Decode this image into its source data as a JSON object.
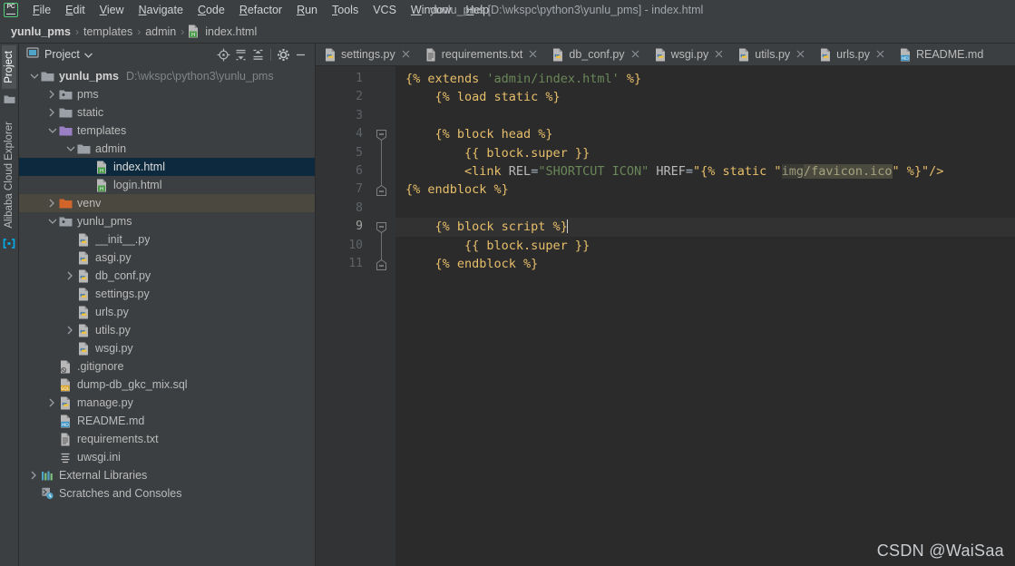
{
  "window": {
    "title": "yunlu_pms [D:\\wkspc\\python3\\yunlu_pms] - index.html",
    "logo_text": "PC"
  },
  "menubar": {
    "items": [
      {
        "label": "File",
        "mnemonic": "F"
      },
      {
        "label": "Edit",
        "mnemonic": "E"
      },
      {
        "label": "View",
        "mnemonic": "V"
      },
      {
        "label": "Navigate",
        "mnemonic": "N"
      },
      {
        "label": "Code",
        "mnemonic": "C"
      },
      {
        "label": "Refactor",
        "mnemonic": "R"
      },
      {
        "label": "Run",
        "mnemonic": "R"
      },
      {
        "label": "Tools",
        "mnemonic": "T"
      },
      {
        "label": "VCS",
        "mnemonic": ""
      },
      {
        "label": "Window",
        "mnemonic": "W"
      },
      {
        "label": "Help",
        "mnemonic": "H"
      }
    ]
  },
  "breadcrumb": {
    "items": [
      "yunlu_pms",
      "templates",
      "admin",
      "index.html"
    ],
    "separator": "›",
    "file_icon": "html-file-icon"
  },
  "toolstrip": {
    "tabs": [
      {
        "label": "Project",
        "active": true,
        "icon": "folder-icon"
      },
      {
        "label": "Alibaba Cloud Explorer",
        "active": false,
        "icon": "cloud-bracket-icon"
      }
    ]
  },
  "project_panel": {
    "title": "Project",
    "caret_icon": "chevron-down-icon",
    "buttons": [
      {
        "name": "locate-icon",
        "title": "Select Opened File"
      },
      {
        "name": "expand-all-icon",
        "title": "Expand All"
      },
      {
        "name": "collapse-all-icon",
        "title": "Collapse All"
      },
      {
        "name": "gear-icon",
        "title": "Settings"
      },
      {
        "name": "minimize-icon",
        "title": "Hide"
      }
    ],
    "tree": [
      {
        "label": "yunlu_pms",
        "path": "D:\\wkspc\\python3\\yunlu_pms",
        "indent": 0,
        "arrow": "down",
        "icon": "module-folder",
        "bold": true,
        "state": "normal"
      },
      {
        "label": "pms",
        "indent": 1,
        "arrow": "right",
        "icon": "package-folder",
        "state": "normal"
      },
      {
        "label": "static",
        "indent": 1,
        "arrow": "right",
        "icon": "folder-gray",
        "state": "normal"
      },
      {
        "label": "templates",
        "indent": 1,
        "arrow": "down",
        "icon": "folder-purple",
        "state": "normal"
      },
      {
        "label": "admin",
        "indent": 2,
        "arrow": "down",
        "icon": "folder-gray",
        "state": "normal"
      },
      {
        "label": "index.html",
        "indent": 3,
        "arrow": "none",
        "icon": "html-file",
        "state": "selected"
      },
      {
        "label": "login.html",
        "indent": 3,
        "arrow": "none",
        "icon": "html-file",
        "state": "normal"
      },
      {
        "label": "venv",
        "indent": 1,
        "arrow": "right",
        "icon": "folder-orange",
        "state": "highlight"
      },
      {
        "label": "yunlu_pms",
        "indent": 1,
        "arrow": "down",
        "icon": "package-folder",
        "state": "normal"
      },
      {
        "label": "__init__.py",
        "indent": 2,
        "arrow": "none",
        "icon": "py-file",
        "state": "normal"
      },
      {
        "label": "asgi.py",
        "indent": 2,
        "arrow": "none",
        "icon": "py-file",
        "state": "normal"
      },
      {
        "label": "db_conf.py",
        "indent": 2,
        "arrow": "right",
        "icon": "py-file",
        "state": "normal"
      },
      {
        "label": "settings.py",
        "indent": 2,
        "arrow": "none",
        "icon": "py-file",
        "state": "normal"
      },
      {
        "label": "urls.py",
        "indent": 2,
        "arrow": "none",
        "icon": "py-file",
        "state": "normal"
      },
      {
        "label": "utils.py",
        "indent": 2,
        "arrow": "right",
        "icon": "py-file",
        "state": "normal"
      },
      {
        "label": "wsgi.py",
        "indent": 2,
        "arrow": "none",
        "icon": "py-file",
        "state": "normal"
      },
      {
        "label": ".gitignore",
        "indent": 1,
        "arrow": "none",
        "icon": "gitignore-file",
        "state": "normal"
      },
      {
        "label": "dump-db_gkc_mix.sql",
        "indent": 1,
        "arrow": "none",
        "icon": "sql-file",
        "state": "normal"
      },
      {
        "label": "manage.py",
        "indent": 1,
        "arrow": "right",
        "icon": "py-file",
        "state": "normal"
      },
      {
        "label": "README.md",
        "indent": 1,
        "arrow": "none",
        "icon": "md-file",
        "state": "normal"
      },
      {
        "label": "requirements.txt",
        "indent": 1,
        "arrow": "none",
        "icon": "txt-file",
        "state": "normal"
      },
      {
        "label": "uwsgi.ini",
        "indent": 1,
        "arrow": "none",
        "icon": "ini-file",
        "state": "normal"
      },
      {
        "label": "External Libraries",
        "indent": 0,
        "arrow": "right",
        "icon": "library-icon",
        "state": "normal"
      },
      {
        "label": "Scratches and Consoles",
        "indent": 0,
        "arrow": "none",
        "icon": "scratches-icon",
        "state": "normal"
      }
    ]
  },
  "editor_tabs": [
    {
      "label": "settings.py",
      "icon": "py-file",
      "closable": true,
      "active": false
    },
    {
      "label": "requirements.txt",
      "icon": "txt-file",
      "closable": true,
      "active": false
    },
    {
      "label": "db_conf.py",
      "icon": "py-file",
      "closable": true,
      "active": false
    },
    {
      "label": "wsgi.py",
      "icon": "py-file",
      "closable": true,
      "active": false
    },
    {
      "label": "utils.py",
      "icon": "py-file",
      "closable": true,
      "active": false
    },
    {
      "label": "urls.py",
      "icon": "py-file",
      "closable": true,
      "active": false
    },
    {
      "label": "README.md",
      "icon": "md-file",
      "closable": false,
      "active": false
    }
  ],
  "editor": {
    "line_numbers": [
      "1",
      "2",
      "3",
      "4",
      "5",
      "6",
      "7",
      "8",
      "9",
      "10",
      "11"
    ],
    "current_line": 9,
    "fold_lines": [
      4,
      7,
      9,
      11
    ],
    "lines": [
      {
        "n": 1,
        "tokens": [
          {
            "t": "{% ",
            "c": "tag"
          },
          {
            "t": "extends ",
            "c": "tag"
          },
          {
            "t": "'admin/index.html'",
            "c": "str"
          },
          {
            "t": " %}",
            "c": "tag"
          }
        ]
      },
      {
        "n": 2,
        "tokens": [
          {
            "t": "    {% load static %}",
            "c": "tag"
          }
        ]
      },
      {
        "n": 3,
        "tokens": []
      },
      {
        "n": 4,
        "tokens": [
          {
            "t": "    {% block head %}",
            "c": "tag"
          }
        ]
      },
      {
        "n": 5,
        "tokens": [
          {
            "t": "        {{ block.super }}",
            "c": "tag"
          }
        ]
      },
      {
        "n": 6,
        "tokens": [
          {
            "t": "        ",
            "c": "plain"
          },
          {
            "t": "<link",
            "c": "tag"
          },
          {
            "t": " REL",
            "c": "attr"
          },
          {
            "t": "=",
            "c": "plain"
          },
          {
            "t": "\"SHORTCUT ICON\"",
            "c": "str"
          },
          {
            "t": " HREF",
            "c": "attr"
          },
          {
            "t": "=",
            "c": "plain"
          },
          {
            "t": "\"{% static \"",
            "c": "tag"
          },
          {
            "t": "img",
            "c": "inj"
          },
          {
            "t": "/",
            "c": "inj2"
          },
          {
            "t": "favicon.ico",
            "c": "inj2"
          },
          {
            "t": "\" %}\"",
            "c": "tag"
          },
          {
            "t": "/>",
            "c": "tag"
          }
        ]
      },
      {
        "n": 7,
        "tokens": [
          {
            "t": "{% endblock %}",
            "c": "tag"
          }
        ]
      },
      {
        "n": 8,
        "tokens": []
      },
      {
        "n": 9,
        "tokens": [
          {
            "t": "    {% block script %}",
            "c": "tag"
          }
        ],
        "caret": true
      },
      {
        "n": 10,
        "tokens": [
          {
            "t": "        {{ block.super }}",
            "c": "tag"
          }
        ]
      },
      {
        "n": 11,
        "tokens": [
          {
            "t": "    {% endblock %}",
            "c": "tag"
          }
        ]
      }
    ]
  },
  "watermark": "CSDN @WaiSaa",
  "colors": {
    "chrome": "#3c3f41",
    "editor_bg": "#2b2b2b",
    "gutter_bg": "#313335",
    "selection": "#0d293e",
    "highlight_row": "#4b4840",
    "tag": "#e8bf6a",
    "string": "#6a8759",
    "plain": "#a9b7c6",
    "accent_green": "#53c97a"
  }
}
